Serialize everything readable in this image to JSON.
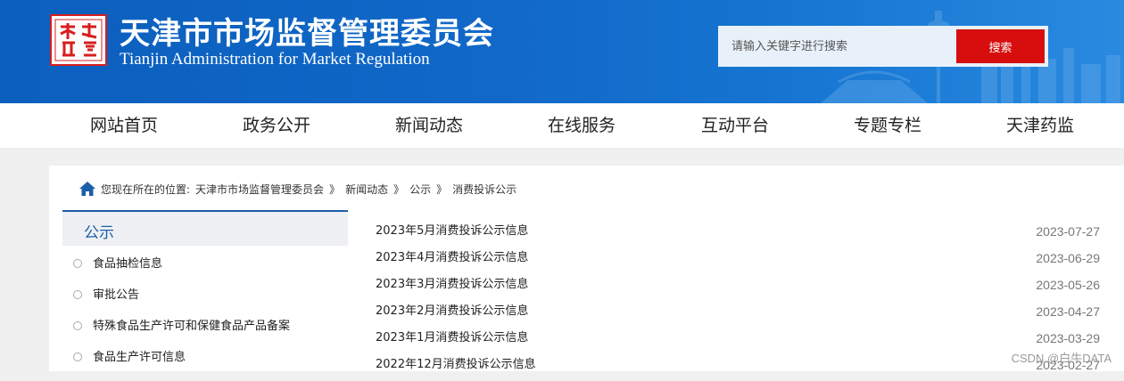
{
  "header": {
    "title": "天津市市场监督管理委员会",
    "subtitle": "Tianjin Administration for Market Regulation",
    "logo_seal_text": "天津市场监管"
  },
  "search": {
    "placeholder": "请输入关键字进行搜索",
    "button_label": "搜索"
  },
  "nav": {
    "items": [
      "网站首页",
      "政务公开",
      "新闻动态",
      "在线服务",
      "互动平台",
      "专题专栏",
      "天津药监"
    ]
  },
  "breadcrumb": {
    "prefix": "您现在所在的位置:",
    "crumbs": [
      "天津市市场监督管理委员会",
      "新闻动态",
      "公示",
      "消费投诉公示"
    ],
    "separator": "》"
  },
  "sidebar": {
    "title": "公示",
    "items": [
      "食品抽检信息",
      "审批公告",
      "特殊食品生产许可和保健食品产品备案",
      "食品生产许可信息"
    ]
  },
  "list": {
    "rows": [
      {
        "title": "2023年5月消费投诉公示信息",
        "date": "2023-07-27"
      },
      {
        "title": "2023年4月消费投诉公示信息",
        "date": "2023-06-29"
      },
      {
        "title": "2023年3月消费投诉公示信息",
        "date": "2023-05-26"
      },
      {
        "title": "2023年2月消费投诉公示信息",
        "date": "2023-04-27"
      },
      {
        "title": "2023年1月消费投诉公示信息",
        "date": "2023-03-29"
      },
      {
        "title": "2022年12月消费投诉公示信息",
        "date": "2023-02-27"
      }
    ]
  },
  "watermark": "CSDN @白牛DATA",
  "colors": {
    "header_blue": "#1168c8",
    "search_button_red": "#d60e0e",
    "accent_blue": "#1d5ea8"
  }
}
